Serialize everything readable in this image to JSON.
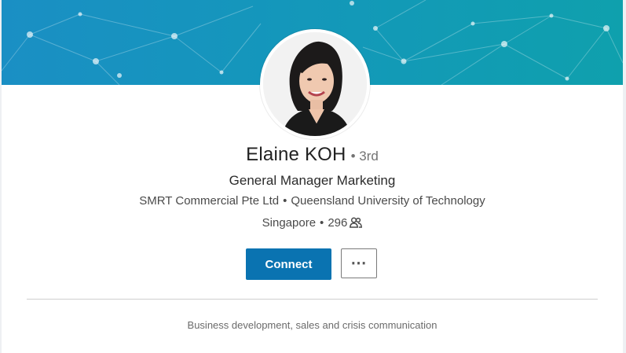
{
  "profile": {
    "name": "Elaine KOH",
    "degree": "• 3rd",
    "headline": "General Manager Marketing",
    "company": "SMRT Commercial Pte Ltd",
    "separator": "•",
    "school": "Queensland University of Technology",
    "location": "Singapore",
    "connections": "296",
    "connections_icon": "people-icon",
    "summary": "Business development, sales and crisis communication"
  },
  "actions": {
    "connect_label": "Connect",
    "more_label": "⋯",
    "more_icon": "more-horizontal-icon"
  },
  "colors": {
    "banner_start": "#1a8fc4",
    "banner_end": "#0fa0ad",
    "primary_button": "#0a73b1"
  }
}
